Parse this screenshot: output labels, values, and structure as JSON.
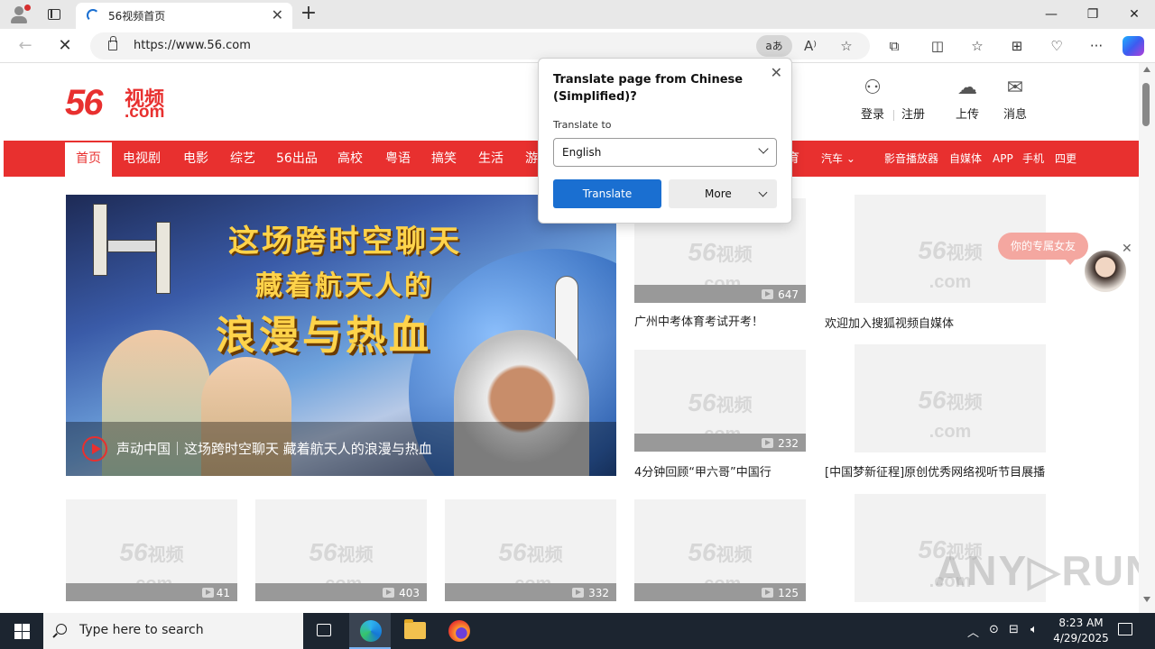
{
  "browser": {
    "tab_title": "56视频首页",
    "tab_close": "✕",
    "new_tab": "+",
    "url": "https://www.56.com",
    "translate_badge": "aあ",
    "window": {
      "minimize": "—",
      "maximize": "❐",
      "close": "✕"
    }
  },
  "header": {
    "logo_num": "56",
    "logo_cn": "视频",
    "logo_com": ".com",
    "actions": [
      {
        "label": "登录",
        "icon": "user-icon"
      },
      {
        "label": "注册",
        "icon": ""
      },
      {
        "label": "上传",
        "icon": "cloud-upload-icon"
      },
      {
        "label": "消息",
        "icon": "mail-icon"
      }
    ]
  },
  "nav": {
    "items": [
      "首页",
      "电视剧",
      "电影",
      "综艺",
      "56出品",
      "高校",
      "粤语",
      "搞笑",
      "生活",
      "游"
    ],
    "right_items": [
      "育",
      "汽车",
      "影音播放器",
      "自媒体",
      "APP",
      "手机",
      "四更"
    ]
  },
  "hero": {
    "title1": "这场跨时空聊天",
    "title2": "藏着航天人的",
    "title3": "浪漫与热血",
    "caption": "声动中国｜这场跨时空聊天 藏着航天人的浪漫与热血"
  },
  "videos": {
    "row1": [
      {
        "count": "647",
        "title": "广州中考体育考试开考！"
      },
      {
        "count": "",
        "title": "欢迎加入搜狐视频自媒体"
      }
    ],
    "row2": [
      {
        "count": "232",
        "title": "4分钟回顾“甲六哥”中国行"
      },
      {
        "count": "",
        "title": "[中国梦新征程]原创优秀网络视听节目展播"
      }
    ],
    "row3": [
      {
        "count": "41"
      },
      {
        "count": "403"
      },
      {
        "count": "332"
      },
      {
        "count": "125"
      },
      {
        "count": ""
      }
    ],
    "watermark_num": "56",
    "watermark_cn": "视频",
    "watermark_com": ".com"
  },
  "ad": {
    "bubble": "你的专属女友"
  },
  "translate_popup": {
    "title": "Translate page from Chinese (Simplified)?",
    "to_label": "Translate to",
    "language": "English",
    "translate_button": "Translate",
    "more_button": "More"
  },
  "watermark": "ANY▷RUN",
  "taskbar": {
    "search_placeholder": "Type here to search",
    "time": "8:23 AM",
    "date": "4/29/2025"
  },
  "colors": {
    "brand_red": "#e8302f",
    "accent_blue": "#1a6fd1"
  }
}
